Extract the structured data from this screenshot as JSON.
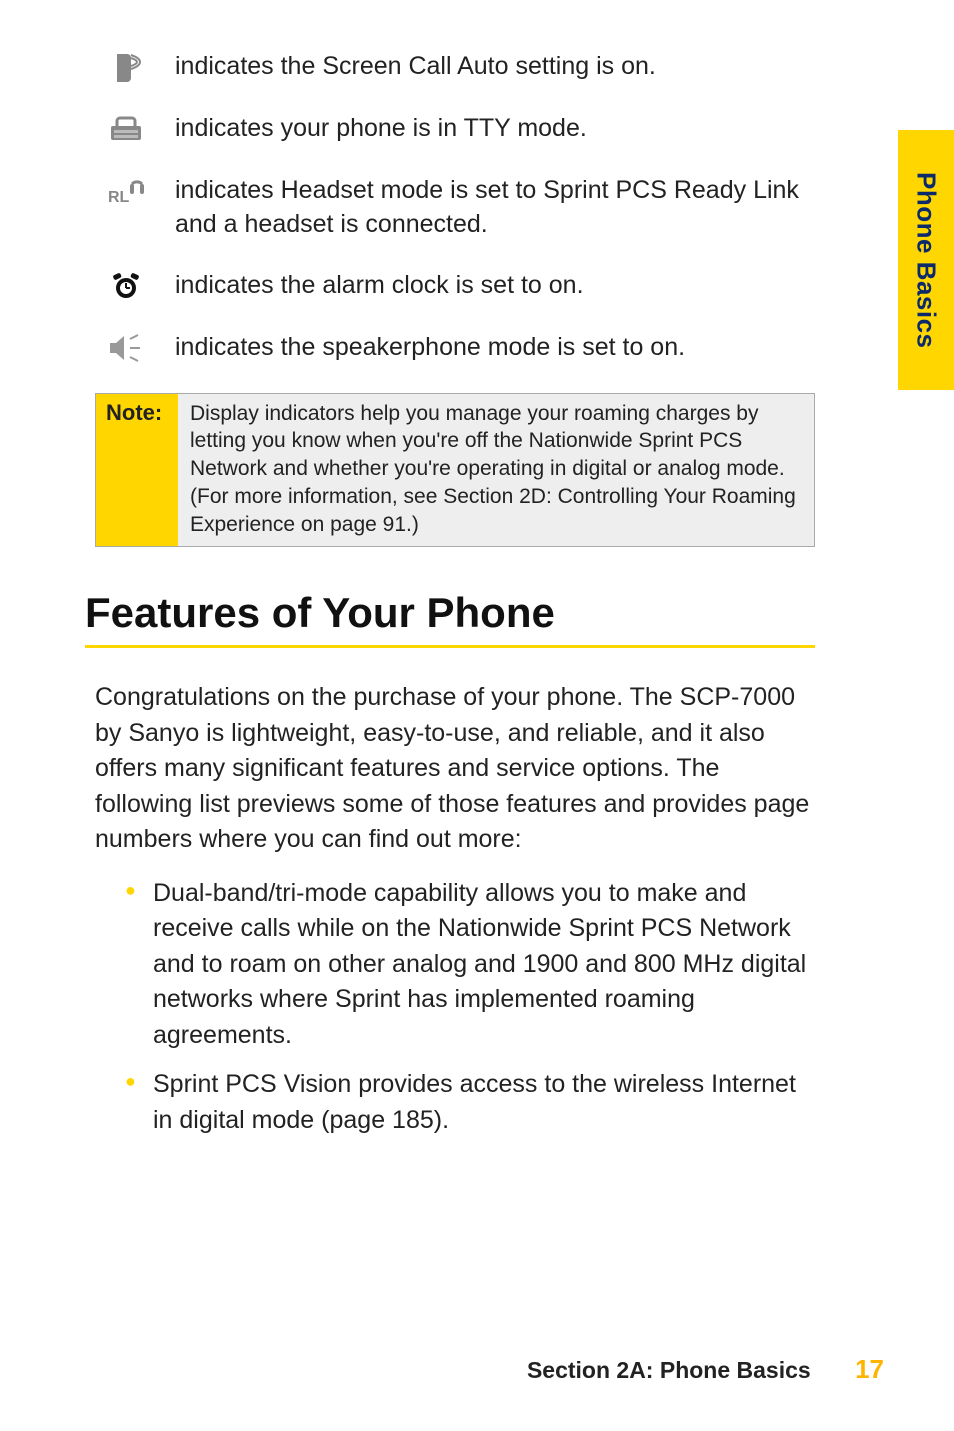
{
  "sideTab": "Phone Basics",
  "indicators": [
    {
      "text": "indicates the Screen Call Auto setting is on."
    },
    {
      "text": "indicates your phone is in TTY mode."
    },
    {
      "text": "indicates Headset mode is set to Sprint PCS Ready Link and a headset is connected."
    },
    {
      "text": "indicates the alarm clock is set to on."
    },
    {
      "text": "indicates the speakerphone mode is set to on."
    }
  ],
  "note": {
    "label": "Note:",
    "body": "Display indicators help you manage your roaming charges by letting you know when you're off the Nationwide Sprint PCS Network and whether you're operating in digital or analog mode. (For more information, see Section 2D: Controlling Your Roaming Experience on page 91.)"
  },
  "heading": "Features of Your Phone",
  "intro": "Congratulations on the purchase of your phone. The SCP-7000 by Sanyo is lightweight, easy-to-use, and reliable, and it also offers many significant features and service options. The following list previews some of those features and provides page numbers where you can find out more:",
  "bullets": [
    "Dual-band/tri-mode capability allows you to make and receive calls while on the Nationwide Sprint PCS Network and to roam on other analog and 1900 and 800 MHz digital networks where Sprint has implemented roaming agreements.",
    "Sprint PCS Vision provides access to the wireless Internet in digital mode (page 185)."
  ],
  "footer": {
    "section": "Section 2A: Phone Basics",
    "page": "17"
  }
}
